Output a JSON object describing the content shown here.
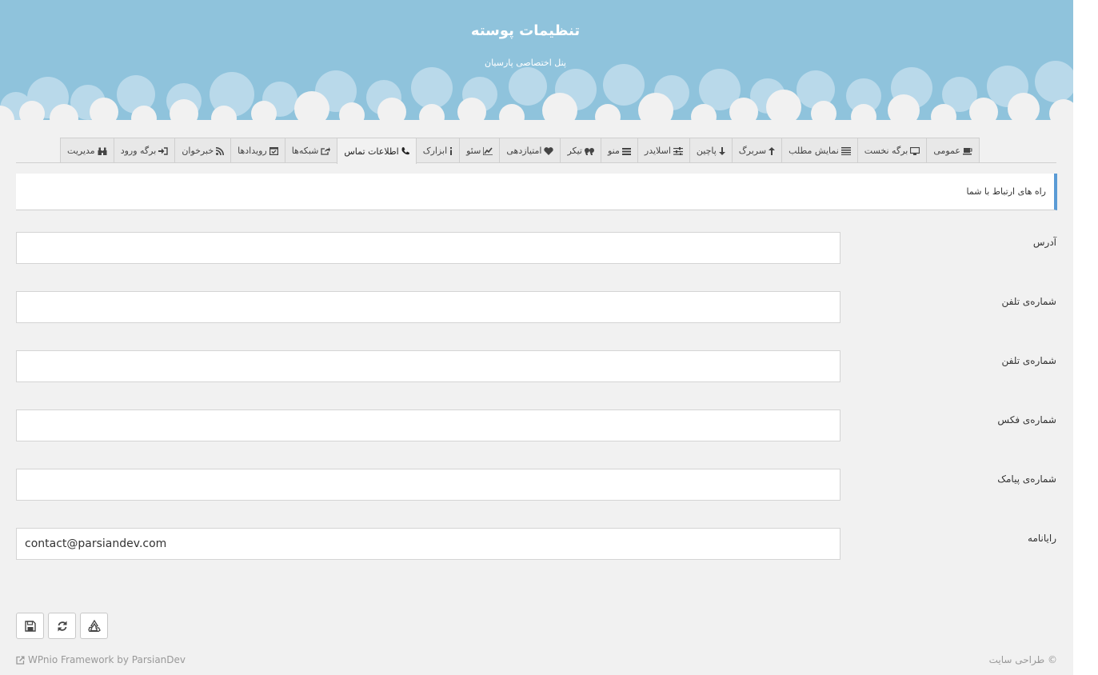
{
  "header": {
    "title": "تنظیمات پوسته",
    "subtitle": "پنل اختصاصی پارسیان"
  },
  "tabs": [
    {
      "label": "عمومی",
      "icon": "coffee-icon"
    },
    {
      "label": "برگه نخست",
      "icon": "desktop-icon"
    },
    {
      "label": "نمایش مطلب",
      "icon": "align-justify-icon"
    },
    {
      "label": "سربرگ",
      "icon": "arrow-up-icon"
    },
    {
      "label": "پاچین",
      "icon": "arrow-down-icon"
    },
    {
      "label": "اسلایدر",
      "icon": "sliders-icon"
    },
    {
      "label": "منو",
      "icon": "bars-icon"
    },
    {
      "label": "تیکر",
      "icon": "quote-icon"
    },
    {
      "label": "امتیازدهی",
      "icon": "heart-icon"
    },
    {
      "label": "سئو",
      "icon": "chart-line-icon"
    },
    {
      "label": "ابزارک",
      "icon": "info-icon"
    },
    {
      "label": "اطلاعات تماس",
      "icon": "phone-icon",
      "active": true
    },
    {
      "label": "شبکه‌ها",
      "icon": "share-square-icon"
    },
    {
      "label": "رویدادها",
      "icon": "calendar-check-icon"
    },
    {
      "label": "خبرخوان",
      "icon": "rss-icon"
    },
    {
      "label": "برگه ورود",
      "icon": "sign-in-icon"
    },
    {
      "label": "مدیریت",
      "icon": "binoculars-icon"
    }
  ],
  "section": {
    "title": "راه های ارتباط با شما"
  },
  "fields": [
    {
      "label": "آدرس",
      "value": ""
    },
    {
      "label": "شماره‌ی تلفن",
      "value": ""
    },
    {
      "label": "شماره‌ی تلفن",
      "value": ""
    },
    {
      "label": "شماره‌ی فکس",
      "value": ""
    },
    {
      "label": "شماره‌ی پیامک",
      "value": ""
    },
    {
      "label": "رایانامه",
      "value": "contact@parsiandev.com"
    }
  ],
  "buttons": {
    "save": "save-icon",
    "reset": "refresh-icon",
    "restore": "recycle-icon"
  },
  "footer": {
    "credit": "WPnio Framework by ParsianDev",
    "copyright": "© طراحی سایت"
  },
  "colors": {
    "header_bg": "#8fc3dc",
    "page_bg": "#f1f1f1",
    "accent": "#5b9bd5"
  }
}
